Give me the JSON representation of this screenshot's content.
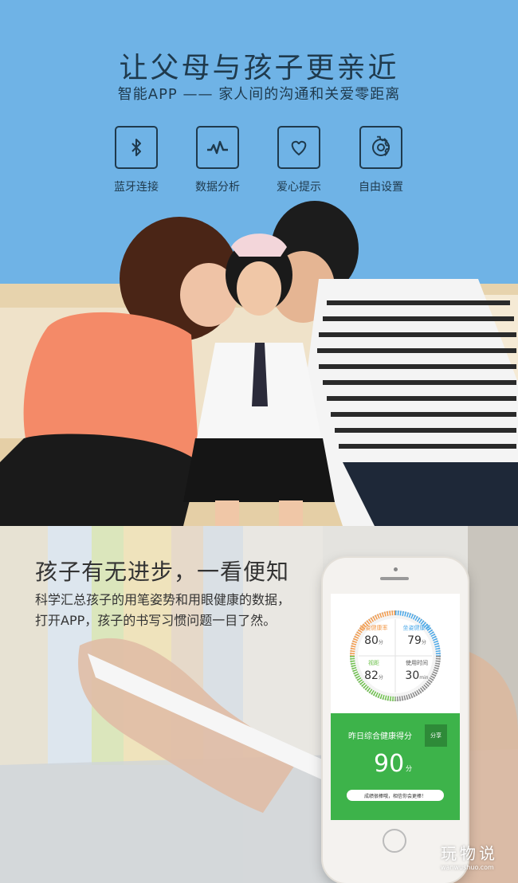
{
  "banner": {
    "title": "让父母与孩子更亲近",
    "subtitle": "智能APP —— 家人间的沟通和关爱零距离",
    "features": [
      {
        "icon": "bluetooth-icon",
        "label": "蓝牙连接"
      },
      {
        "icon": "pulse-icon",
        "label": "数据分析"
      },
      {
        "icon": "heart-icon",
        "label": "爱心提示"
      },
      {
        "icon": "gear-icon",
        "label": "自由设置"
      }
    ]
  },
  "section": {
    "title": "孩子有无进步，一看便知",
    "desc_line1": "科学汇总孩子的用笔姿势和用眼健康的数据，",
    "desc_line2": "打开APP，孩子的书写习惯问题一目了然。"
  },
  "app": {
    "metrics": [
      {
        "label": "握姿健康率",
        "value": "80",
        "unit": "分",
        "color": "#f39a4a"
      },
      {
        "label": "坐姿健康率",
        "value": "79",
        "unit": "分",
        "color": "#4aa8e8"
      },
      {
        "label": "视距",
        "value": "82",
        "unit": "分",
        "color": "#6cc04a"
      },
      {
        "label": "使用时间",
        "value": "30",
        "unit": "min",
        "color": "#555555"
      }
    ],
    "score_title": "昨日综合健康得分",
    "share_label": "分享",
    "score": "90",
    "score_unit": "分",
    "message": "成绩很棒哦，相信你会更棒！"
  },
  "watermark": {
    "main": "玩物说",
    "sub": "wanwushuo.com"
  },
  "colors": {
    "banner_bg": "#6fb3e6",
    "app_green": "#3db34a"
  }
}
